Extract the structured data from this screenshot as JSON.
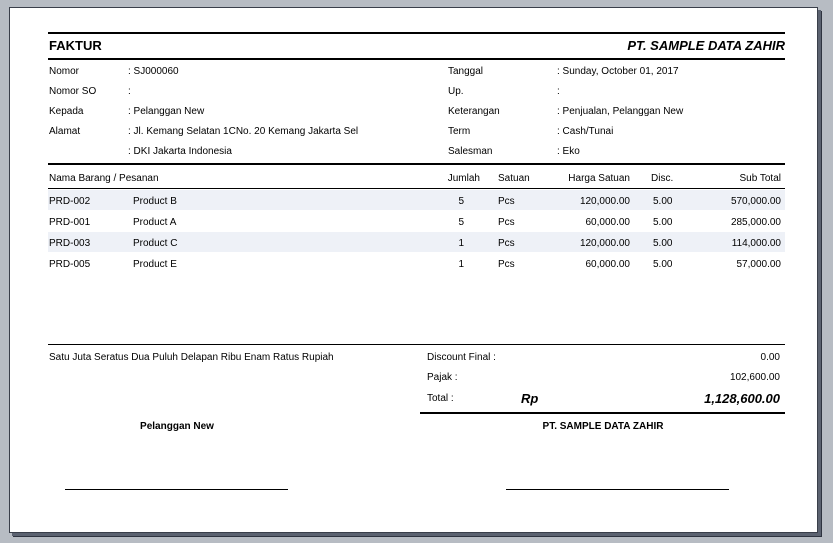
{
  "header": {
    "title": "FAKTUR",
    "company": "PT. SAMPLE DATA ZAHIR"
  },
  "info_left": [
    {
      "label": "Nomor",
      "value": ": SJ000060"
    },
    {
      "label": "Nomor SO",
      "value": ":"
    },
    {
      "label": "Kepada",
      "value": ": Pelanggan New"
    },
    {
      "label": "Alamat",
      "value": ": Jl. Kemang Selatan 1CNo. 20 Kemang Jakarta Sel"
    },
    {
      "label": "",
      "value": ": DKI Jakarta  Indonesia"
    }
  ],
  "info_right": [
    {
      "label": "Tanggal",
      "value": ": Sunday, October 01, 2017"
    },
    {
      "label": "Up.",
      "value": ":"
    },
    {
      "label": "Keterangan",
      "value": ": Penjualan, Pelanggan New"
    },
    {
      "label": "Term",
      "value": ": Cash/Tunai"
    },
    {
      "label": "Salesman",
      "value": ": Eko"
    }
  ],
  "table": {
    "headers": {
      "item": "Nama Barang / Pesanan",
      "qty": "Jumlah",
      "unit": "Satuan",
      "price": "Harga Satuan",
      "disc": "Disc.",
      "subtotal": "Sub Total"
    },
    "rows": [
      {
        "code": "PRD-002",
        "name": "Product B",
        "qty": "5",
        "unit": "Pcs",
        "price": "120,000.00",
        "disc": "5.00",
        "subtotal": "570,000.00"
      },
      {
        "code": "PRD-001",
        "name": "Product A",
        "qty": "5",
        "unit": "Pcs",
        "price": "60,000.00",
        "disc": "5.00",
        "subtotal": "285,000.00"
      },
      {
        "code": "PRD-003",
        "name": "Product C",
        "qty": "1",
        "unit": "Pcs",
        "price": "120,000.00",
        "disc": "5.00",
        "subtotal": "114,000.00"
      },
      {
        "code": "PRD-005",
        "name": "Product E",
        "qty": "1",
        "unit": "Pcs",
        "price": "60,000.00",
        "disc": "5.00",
        "subtotal": "57,000.00"
      }
    ]
  },
  "footer": {
    "terbilang": "Satu Juta Seratus Dua Puluh Delapan Ribu Enam Ratus Rupiah",
    "discount_label": "Discount Final :",
    "discount_value": "0.00",
    "pajak_label": "Pajak :",
    "pajak_value": "102,600.00",
    "total_label": "Total :",
    "currency": "Rp",
    "total_value": "1,128,600.00",
    "sign_left": "Pelanggan New",
    "sign_right": "PT. SAMPLE DATA ZAHIR"
  }
}
